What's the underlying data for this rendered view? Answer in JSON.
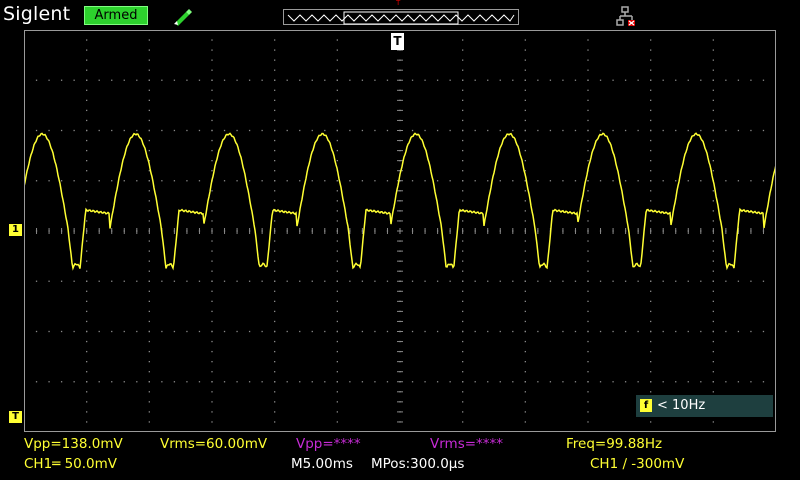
{
  "header": {
    "brand": "Siglent",
    "status": "Armed",
    "trigger_marker": "T"
  },
  "icons": [
    "probe-icon",
    "network-icon",
    "trigger-position-icon",
    "channel-1-marker",
    "trigger-level-marker",
    "freq-icon"
  ],
  "colors": {
    "ch1": "#ffff33",
    "grid": "#8a8a8a",
    "status": "#2dd12d",
    "math": "#c72bd6"
  },
  "screen": {
    "ch1_marker": "1",
    "trig_level_marker": "T",
    "trig_position_marker": "T"
  },
  "counter": {
    "icon": "f",
    "text": "< 10Hz"
  },
  "measurements": {
    "ch1_vpp": "Vpp=138.0mV",
    "ch1_vrms": "Vrms=60.00mV",
    "ch2_vpp": "Vpp=****",
    "ch2_vrms": "Vrms=****",
    "freq": "Freq=99.88Hz"
  },
  "bottom": {
    "ch1_scale": "CH1═ 50.0mV",
    "timebase": "M5.00ms",
    "mpos": "MPos:300.0µs",
    "trigger": "CH1 ∕ -300mV"
  },
  "waveform": {
    "frequency_hz": 99.88,
    "vpp_mv": 138.0,
    "volts_per_div_mv": 50.0,
    "time_per_div_ms": 5.0,
    "cycles_visible": 8
  }
}
